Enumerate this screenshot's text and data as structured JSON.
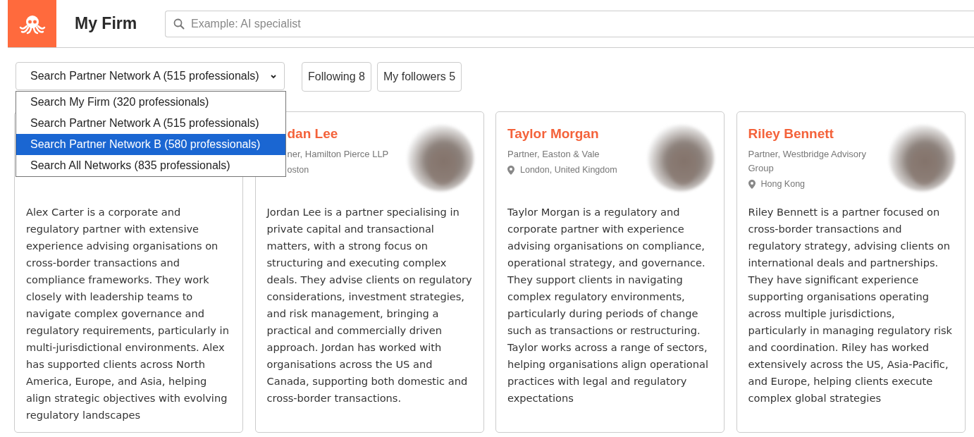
{
  "header": {
    "title": "My Firm",
    "search": {
      "placeholder": "Example: AI specialist"
    }
  },
  "network_select": {
    "value": "Search Partner Network A (515 professionals)",
    "open": true,
    "options": [
      {
        "label": "Search My Firm (320 professionals)",
        "highlighted": false
      },
      {
        "label": "Search Partner Network A (515 professionals)",
        "highlighted": false
      },
      {
        "label": "Search Partner Network B (580 professionals)",
        "highlighted": true
      },
      {
        "label": "Search All Networks (835 professionals)",
        "highlighted": false
      }
    ]
  },
  "buttons": [
    "Following 8",
    "My followers 5"
  ],
  "cards": [
    {
      "bio": "Alex Carter is a corporate and regulatory partner with extensive experience advising organisations on cross-border transactions and compliance frameworks. They work closely with leadership teams to navigate complex governance and regulatory requirements, particularly in multi-jurisdictional environments. Alex has supported clients across North America, Europe, and Asia, helping align strategic objectives with evolving regulatory landscapes"
    },
    {
      "clipped": true,
      "name": "dan Lee",
      "title": "ner, Hamilton Pierce LLP",
      "location": "oston",
      "bio": "Jordan Lee is a partner specialising in private capital and transactional matters, with a strong focus on structuring and executing complex deals. They advise clients on regulatory considerations, investment strategies, and risk management, bringing a practical and commercially driven approach. Jordan has worked with organisations across the US and Canada, supporting both domestic and cross-border transactions."
    },
    {
      "clipped": false,
      "name": "Taylor Morgan",
      "title": "Partner, Easton & Vale",
      "location": "London, United Kingdom",
      "bio": "Taylor Morgan is a regulatory and corporate partner with experience advising organisations on compliance, operational strategy, and governance. They support clients in navigating complex regulatory environments, particularly during periods of change such as transactions or restructuring. Taylor works across a range of sectors, helping organisations align operational practices with legal and regulatory expectations"
    },
    {
      "clipped": false,
      "name": "Riley Bennett",
      "title": "Partner, Westbridge Advisory Group",
      "location": "Hong Kong",
      "bio": "Riley Bennett is a partner focused on cross-border transactions and regulatory strategy, advising clients on international deals and partnerships. They have significant experience supporting organisations operating across multiple jurisdictions, particularly in managing regulatory risk and coordination. Riley has worked extensively across the US, Asia-Pacific, and Europe, helping clients execute complex global strategies"
    }
  ]
}
